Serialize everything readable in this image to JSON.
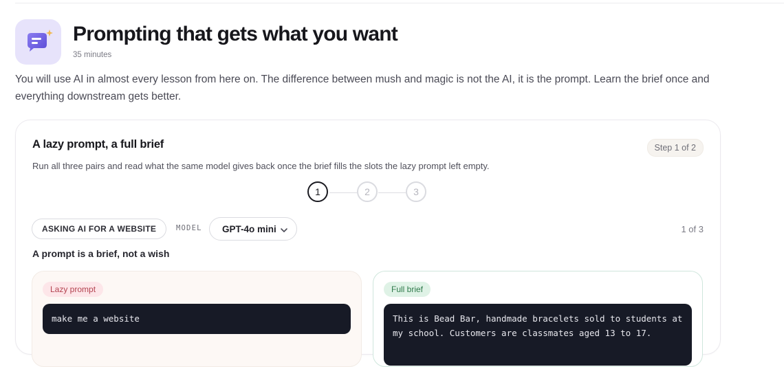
{
  "lesson": {
    "title": "Prompting that gets what you want",
    "duration": "35 minutes",
    "intro": "You will use AI in almost every lesson from here on. The difference between mush and magic is not the AI, it is the prompt. Learn the brief once and everything downstream gets better."
  },
  "activity": {
    "title": "A lazy prompt, a full brief",
    "step_label": "Step 1 of 2",
    "description": "Run all three pairs and read what the same model gives back once the brief fills the slots the lazy prompt left empty.",
    "steps": [
      "1",
      "2",
      "3"
    ],
    "active_step": 1,
    "topic_label": "ASKING AI FOR A WEBSITE",
    "model_label": "MODEL",
    "model_value": "GPT-4o mini",
    "pair_count": "1 of 3",
    "section_heading": "A prompt is a brief, not a wish",
    "lazy": {
      "tag": "Lazy prompt",
      "prompt": "make me a website"
    },
    "full": {
      "tag": "Full brief",
      "prompt": "This is Bead Bar, handmade bracelets sold to students at my school. Customers are classmates aged 13 to 17."
    }
  },
  "colors": {
    "accent_purple": "#6c5ce7",
    "lazy_tag": "#b3424f",
    "full_tag": "#2f7a4b",
    "code_bg": "#171a26"
  },
  "icons": {
    "lesson": "chat-sparkle-icon",
    "dropdown": "chevron-down-icon"
  }
}
